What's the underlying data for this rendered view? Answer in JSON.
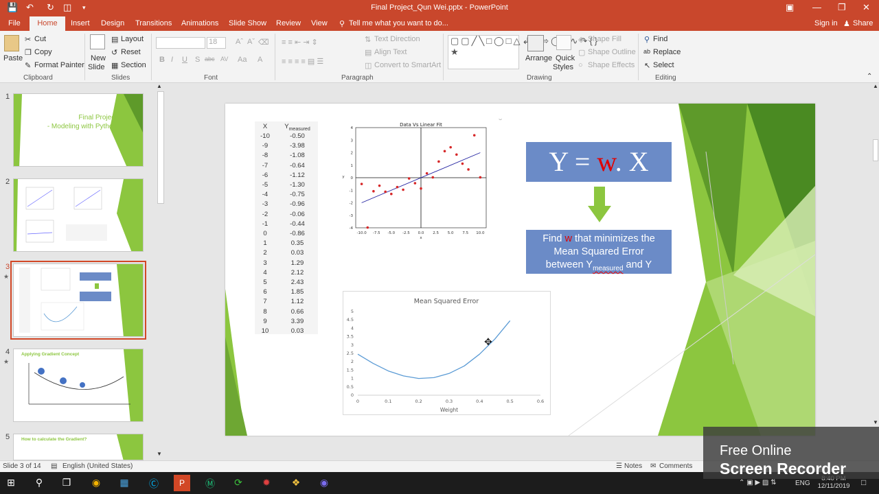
{
  "window": {
    "title": "Final Project_Qun Wei.pptx - PowerPoint",
    "sign_in": "Sign in",
    "share": "Share"
  },
  "tabs": [
    "File",
    "Home",
    "Insert",
    "Design",
    "Transitions",
    "Animations",
    "Slide Show",
    "Review",
    "View"
  ],
  "tell_me": "Tell me what you want to do...",
  "ribbon": {
    "clipboard": {
      "paste": "Paste",
      "cut": "Cut",
      "copy": "Copy",
      "format_painter": "Format Painter",
      "group": "Clipboard"
    },
    "slides": {
      "new_slide_1": "New",
      "new_slide_2": "Slide",
      "layout": "Layout",
      "reset": "Reset",
      "section": "Section",
      "group": "Slides"
    },
    "font": {
      "size": "18",
      "group": "Font",
      "bold": "B",
      "italic": "I",
      "underline": "U",
      "shadow": "S",
      "strike": "abc",
      "spacing": "AV",
      "case": "Aa",
      "color": "A"
    },
    "paragraph": {
      "text_direction": "Text Direction",
      "align_text": "Align Text",
      "convert_smartart": "Convert to SmartArt",
      "group": "Paragraph"
    },
    "drawing": {
      "arrange": "Arrange",
      "quick_styles_1": "Quick",
      "quick_styles_2": "Styles",
      "shape_fill": "Shape Fill",
      "shape_outline": "Shape Outline",
      "shape_effects": "Shape Effects",
      "group": "Drawing"
    },
    "editing": {
      "find": "Find",
      "replace": "Replace",
      "select": "Select",
      "group": "Editing"
    }
  },
  "thumbnails": {
    "nums": [
      "1",
      "2",
      "3",
      "4",
      "5"
    ],
    "slide1_title_1": "Final Project",
    "slide1_title_2": "- Modeling with Python",
    "slide4_title": "Applying Gradient Concept",
    "slide5_title": "How to calculate the Gradient?"
  },
  "slide": {
    "table_header_x": "X",
    "table_header_y": "Y",
    "table_header_y_sub": "measured",
    "table": [
      [
        "-10",
        "-0.50"
      ],
      [
        "-9",
        "-3.98"
      ],
      [
        "-8",
        "-1.08"
      ],
      [
        "-7",
        "-0.64"
      ],
      [
        "-6",
        "-1.12"
      ],
      [
        "-5",
        "-1.30"
      ],
      [
        "-4",
        "-0.75"
      ],
      [
        "-3",
        "-0.96"
      ],
      [
        "-2",
        "-0.06"
      ],
      [
        "-1",
        "-0.44"
      ],
      [
        "0",
        "-0.86"
      ],
      [
        "1",
        "0.35"
      ],
      [
        "2",
        "0.03"
      ],
      [
        "3",
        "1.29"
      ],
      [
        "4",
        "2.12"
      ],
      [
        "5",
        "2.43"
      ],
      [
        "6",
        "1.85"
      ],
      [
        "7",
        "1.12"
      ],
      [
        "8",
        "0.66"
      ],
      [
        "9",
        "3.39"
      ],
      [
        "10",
        "0.03"
      ]
    ],
    "equation_y": "Y = ",
    "equation_w": "w",
    "equation_x": ". X",
    "find_1": "Find ",
    "find_w": "w",
    "find_2": " that minimizes the",
    "find_3": "Mean Squared Error",
    "find_4": "between Y",
    "find_sub": "measured",
    "find_5": " and Y"
  },
  "chart_data": [
    {
      "type": "scatter",
      "title": "Data Vs Linear Fit",
      "xlabel": "x",
      "ylabel": "y",
      "xlim": [
        -11,
        11
      ],
      "ylim": [
        -4,
        4
      ],
      "xticks": [
        "-10.0",
        "-7.5",
        "-5.0",
        "-2.5",
        "0.0",
        "2.5",
        "5.0",
        "7.5",
        "10.0"
      ],
      "yticks": [
        "-4",
        "-3",
        "-2",
        "-1",
        "0",
        "1",
        "2",
        "3",
        "4"
      ],
      "points_x": [
        -10,
        -9,
        -8,
        -7,
        -6,
        -5,
        -4,
        -3,
        -2,
        -1,
        0,
        1,
        2,
        3,
        4,
        5,
        6,
        7,
        8,
        9,
        10
      ],
      "points_y": [
        -0.5,
        -3.98,
        -1.08,
        -0.64,
        -1.12,
        -1.3,
        -0.75,
        -0.96,
        -0.06,
        -0.44,
        -0.86,
        0.35,
        0.03,
        1.29,
        2.12,
        2.43,
        1.85,
        1.12,
        0.66,
        3.39,
        0.03
      ],
      "fit_line": {
        "x": [
          -10,
          10
        ],
        "y": [
          -2.0,
          2.0
        ]
      },
      "point_color": "#d62728",
      "line_color": "#1f1f9f"
    },
    {
      "type": "line",
      "title": "Mean Squared Error",
      "xlabel": "Weight",
      "ylabel": "",
      "xlim": [
        0,
        0.6
      ],
      "ylim": [
        0,
        5
      ],
      "xticks": [
        "0",
        "0.1",
        "0.2",
        "0.3",
        "0.4",
        "0.5",
        "0.6"
      ],
      "yticks": [
        "0",
        "0.5",
        "1",
        "1.5",
        "2",
        "2.5",
        "3",
        "3.5",
        "4",
        "4.5",
        "5"
      ],
      "x": [
        0,
        0.05,
        0.1,
        0.15,
        0.2,
        0.25,
        0.3,
        0.35,
        0.4,
        0.45,
        0.5
      ],
      "y": [
        2.45,
        1.9,
        1.45,
        1.15,
        1.0,
        1.05,
        1.3,
        1.75,
        2.45,
        3.35,
        4.45
      ],
      "line_color": "#5b9bd5"
    }
  ],
  "status": {
    "slide_of": "Slide 3 of 14",
    "language": "English (United States)",
    "notes": "Notes",
    "comments": "Comments"
  },
  "recorder": {
    "line1": "Free Online",
    "line2": "Screen Recorder"
  },
  "clock": {
    "time": "8:40 PM",
    "date": "12/11/2019",
    "lang": "ENG"
  },
  "colors": {
    "accent": "#c9472c",
    "slide_green": "#8cc63f",
    "box_blue": "#6b8bc7"
  }
}
